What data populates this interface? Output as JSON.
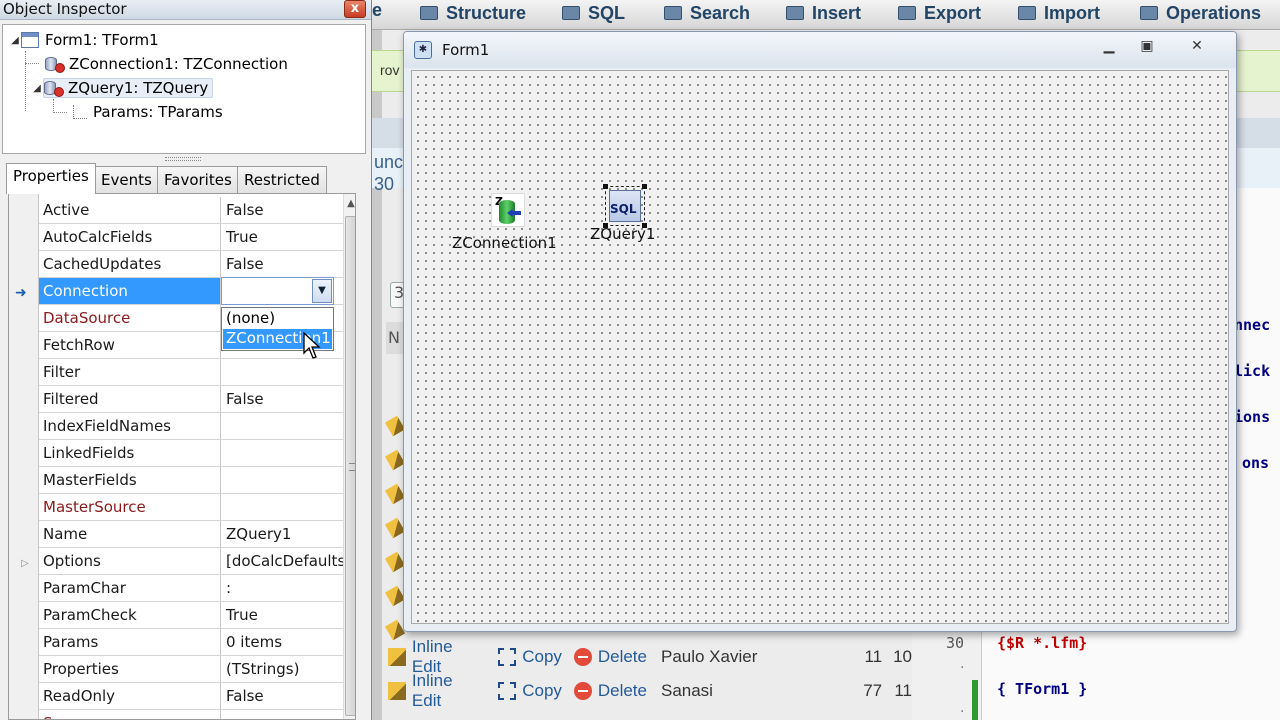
{
  "background": {
    "tab_partial": "e",
    "tabs": [
      "Structure",
      "SQL",
      "Search",
      "Insert",
      "Export",
      "Import",
      "Operations"
    ],
    "green_bar_text": "rov",
    "left_fragments": [
      "unc",
      "30",
      "3",
      "N"
    ],
    "rows": [
      {
        "inline_edit": "Inline Edit",
        "copy": "Copy",
        "delete": "Delete",
        "name": "Paulo Xavier",
        "n1": "11",
        "n2": "10"
      },
      {
        "inline_edit": "Inline Edit",
        "copy": "Copy",
        "delete": "Delete",
        "name": "Sanasi",
        "n1": "77",
        "n2": "11"
      }
    ],
    "code_fragments": [
      "nnec",
      "lick",
      "ions",
      "ons"
    ],
    "code_line_number": "30",
    "code_dot": ".",
    "code_line_1": "{$R *.lfm}",
    "code_line_2": "{ TForm1 }"
  },
  "inspector": {
    "title": "Object Inspector",
    "close_glyph": "x",
    "tree": {
      "root": "Form1: TForm1",
      "connection": "ZConnection1: TZConnection",
      "query": "ZQuery1: TZQuery",
      "params": "Params: TParams"
    },
    "tabs": [
      "Properties",
      "Events",
      "Favorites",
      "Restricted"
    ],
    "active_tab": "Properties",
    "properties": [
      {
        "name": "Active",
        "value": "False",
        "ref": false
      },
      {
        "name": "AutoCalcFields",
        "value": "True",
        "ref": false
      },
      {
        "name": "CachedUpdates",
        "value": "False",
        "ref": false
      },
      {
        "name": "Connection",
        "value": "",
        "ref": false,
        "selected": true
      },
      {
        "name": "DataSource",
        "value": "",
        "ref": true
      },
      {
        "name": "FetchRow",
        "value": "",
        "ref": false
      },
      {
        "name": "Filter",
        "value": "",
        "ref": false
      },
      {
        "name": "Filtered",
        "value": "False",
        "ref": false
      },
      {
        "name": "IndexFieldNames",
        "value": "",
        "ref": false
      },
      {
        "name": "LinkedFields",
        "value": "",
        "ref": false
      },
      {
        "name": "MasterFields",
        "value": "",
        "ref": false
      },
      {
        "name": "MasterSource",
        "value": "",
        "ref": true
      },
      {
        "name": "Name",
        "value": "ZQuery1",
        "ref": false
      },
      {
        "name": "Options",
        "value": "[doCalcDefaults",
        "ref": false
      },
      {
        "name": "ParamChar",
        "value": ":",
        "ref": false
      },
      {
        "name": "ParamCheck",
        "value": "True",
        "ref": false
      },
      {
        "name": "Params",
        "value": "0 items",
        "ref": false
      },
      {
        "name": "Properties",
        "value": "(TStrings)",
        "ref": false
      },
      {
        "name": "ReadOnly",
        "value": "False",
        "ref": false
      },
      {
        "name": "Sequence",
        "value": "",
        "ref": true
      }
    ],
    "dropdown_options": [
      "(none)",
      "ZConnection1"
    ],
    "dropdown_highlighted": "ZConnection1"
  },
  "form": {
    "title": "Form1",
    "components": {
      "connection_label": "ZConnection1",
      "query_label": "ZQuery1",
      "query_icon_text": "SQL",
      "connection_icon_letter": "Z"
    }
  },
  "colors": {
    "selection": "#3399ff",
    "reference_property": "#8b1a1a",
    "link_text": "#235a99"
  }
}
